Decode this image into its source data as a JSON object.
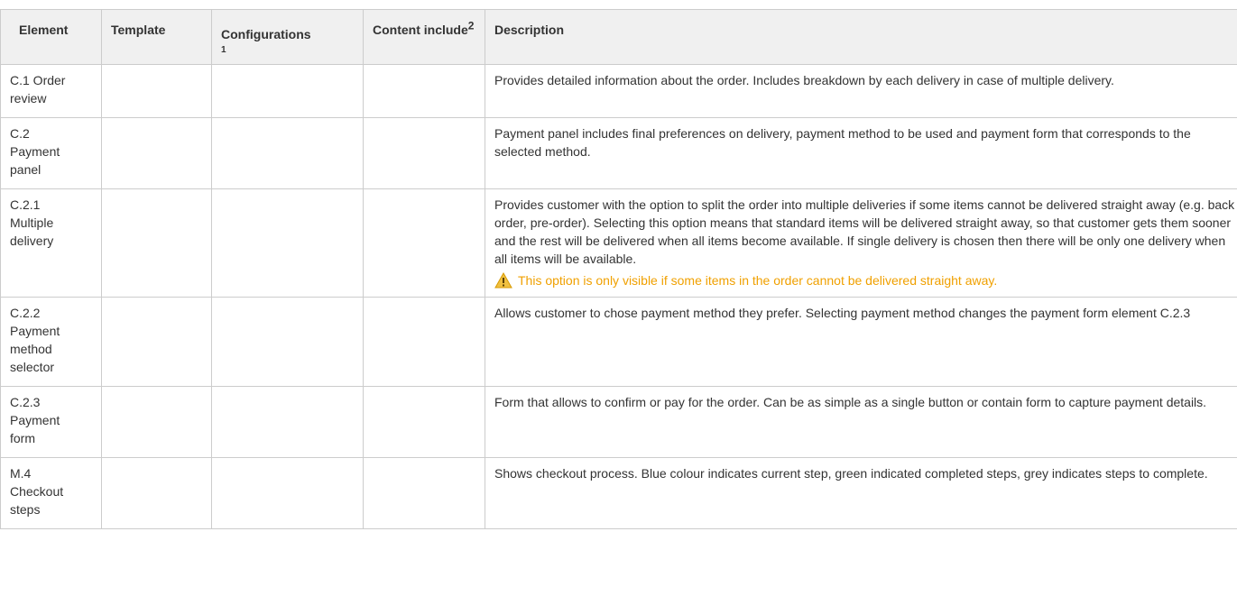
{
  "headers": {
    "element": "Element",
    "template": "Template",
    "configurations": "Configurations",
    "configurations_note": "1",
    "content_include": "Content include",
    "content_include_note": "2",
    "description": "Description"
  },
  "rows": [
    {
      "element": "C.1 Order review",
      "template": "",
      "configurations": "",
      "content_include": "",
      "description": "Provides detailed information about the order. Includes breakdown by each delivery in case of multiple delivery."
    },
    {
      "element": "C.2 Payment panel",
      "template": "",
      "configurations": "",
      "content_include": "",
      "description": "Payment panel includes final preferences on delivery, payment method to be used and payment form that corresponds to the selected method."
    },
    {
      "element": "C.2.1 Multiple delivery",
      "template": "",
      "configurations": "",
      "content_include": "",
      "description": "Provides customer with the option to split the order into multiple deliveries if some items cannot be delivered straight away (e.g. back order, pre-order). Selecting this option means that standard items will be delivered straight away, so that customer gets them sooner and the rest will be delivered when all items become available. If single delivery is chosen then there will be only one delivery when all items will be available.",
      "warning": "This option is only visible if some items in the order cannot be delivered straight away.",
      "warning_icon": "warning-icon"
    },
    {
      "element": "C.2.2 Payment method selector",
      "template": "",
      "configurations": "",
      "content_include": "",
      "description": "Allows customer to chose payment method they prefer. Selecting payment method changes the payment form element C.2.3"
    },
    {
      "element": "C.2.3 Payment form",
      "template": "",
      "configurations": "",
      "content_include": "",
      "description": "Form that allows to confirm or pay for the order. Can be as simple as a single button or contain form to capture payment details."
    },
    {
      "element": "M.4 Checkout steps",
      "template": "",
      "configurations": "",
      "content_include": "",
      "description": "Shows checkout process. Blue colour indicates current step, green indicated completed steps, grey indicates steps to complete."
    }
  ],
  "colors": {
    "header_bg": "#f0f0f0",
    "border": "#cccccc",
    "text": "#333333",
    "warning": "#f0a000"
  }
}
